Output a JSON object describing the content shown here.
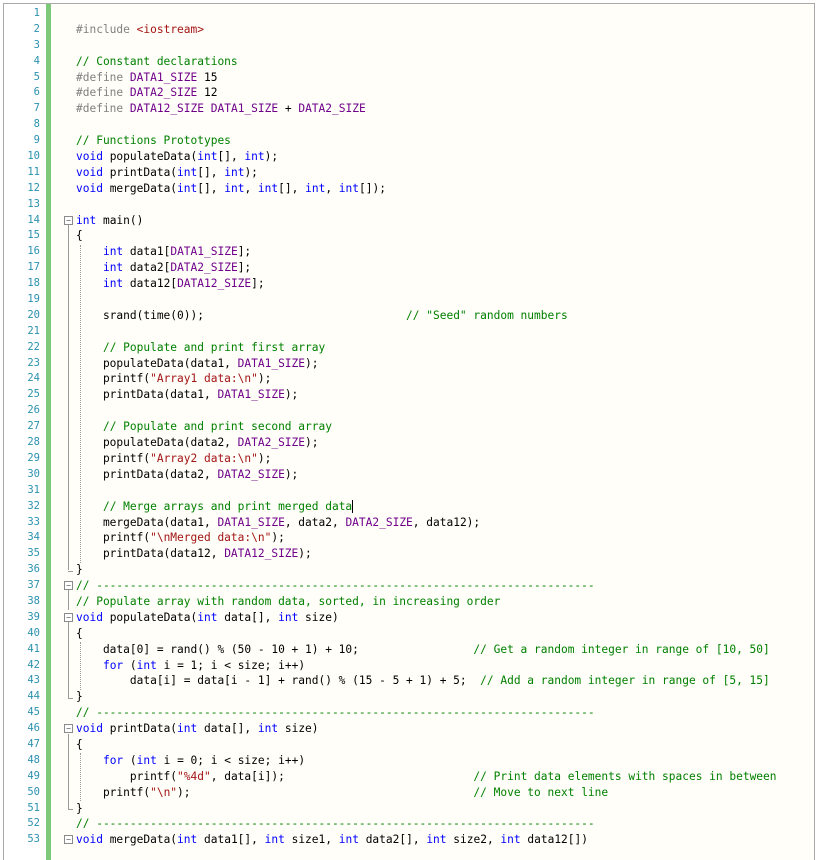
{
  "editor": {
    "language": "cpp",
    "highlight_colors": {
      "keyword": "#0000ff",
      "comment": "#008000",
      "string": "#a31515",
      "macro": "#6f008a",
      "line_number": "#2b91af",
      "change_bar": "#7ec87a"
    },
    "lines": [
      "",
      "#include <iostream>",
      "",
      "// Constant declarations",
      "#define DATA1_SIZE 15",
      "#define DATA2_SIZE 12",
      "#define DATA12_SIZE DATA1_SIZE + DATA2_SIZE",
      "",
      "// Functions Prototypes",
      "void populateData(int[], int);",
      "void printData(int[], int);",
      "void mergeData(int[], int, int[], int, int[]);",
      "",
      "int main()",
      "{",
      "    int data1[DATA1_SIZE];",
      "    int data2[DATA2_SIZE];",
      "    int data12[DATA12_SIZE];",
      "",
      "    srand(time(0));                              // \"Seed\" random numbers",
      "",
      "    // Populate and print first array",
      "    populateData(data1, DATA1_SIZE);",
      "    printf(\"Array1 data:\\n\");",
      "    printData(data1, DATA1_SIZE);",
      "",
      "    // Populate and print second array",
      "    populateData(data2, DATA2_SIZE);",
      "    printf(\"Array2 data:\\n\");",
      "    printData(data2, DATA2_SIZE);",
      "",
      "    // Merge arrays and print merged data",
      "    mergeData(data1, DATA1_SIZE, data2, DATA2_SIZE, data12);",
      "    printf(\"\\nMerged data:\\n\");",
      "    printData(data12, DATA12_SIZE);",
      "}",
      "// --------------------------------------------------------------------------",
      "// Populate array with random data, sorted, in increasing order",
      "void populateData(int data[], int size)",
      "{",
      "    data[0] = rand() % (50 - 10 + 1) + 10;                 // Get a random integer in range of [10, 50]",
      "    for (int i = 1; i < size; i++)",
      "        data[i] = data[i - 1] + rand() % (15 - 5 + 1) + 5;  // Add a random integer in range of [5, 15]",
      "}",
      "// --------------------------------------------------------------------------",
      "void printData(int data[], int size)",
      "{",
      "    for (int i = 0; i < size; i++)",
      "        printf(\"%4d\", data[i]);                            // Print data elements with spaces in between",
      "    printf(\"\\n\");                                          // Move to next line",
      "}",
      "// --------------------------------------------------------------------------",
      "void mergeData(int data1[], int size1, int data2[], int size2, int data12[])"
    ],
    "fold_lines": [
      14,
      37,
      39,
      46,
      53
    ],
    "caret_line": 32
  }
}
